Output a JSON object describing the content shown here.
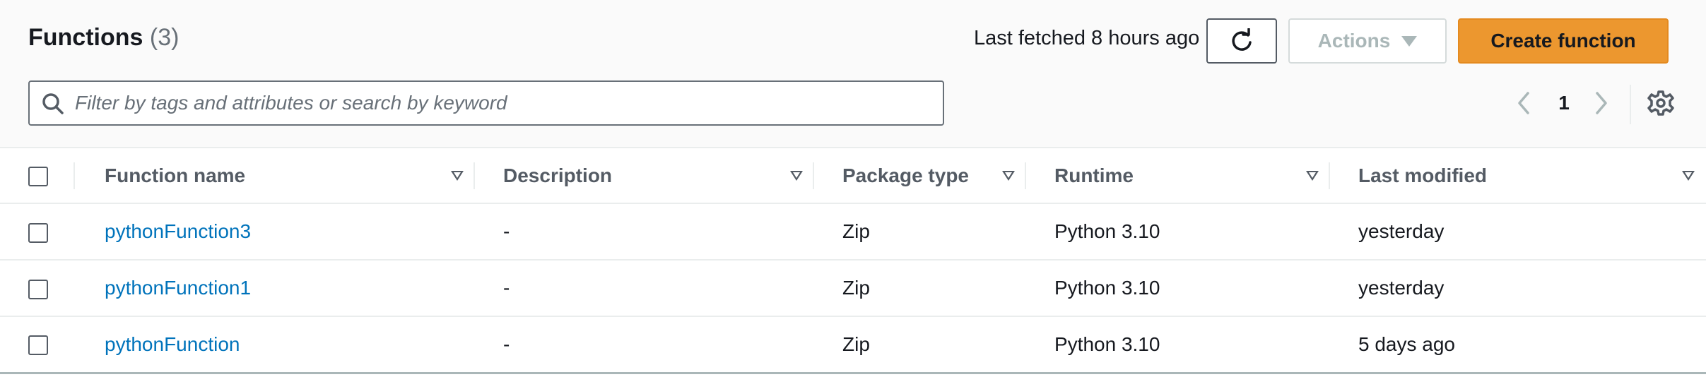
{
  "header": {
    "title": "Functions",
    "count": "(3)",
    "last_fetched": "Last fetched 8 hours ago",
    "refresh_icon": "refresh-icon",
    "actions_label": "Actions",
    "create_label": "Create function",
    "accent_color": "#ec972f"
  },
  "search": {
    "placeholder": "Filter by tags and attributes or search by keyword",
    "value": ""
  },
  "pagination": {
    "page": "1"
  },
  "table": {
    "columns": [
      "Function name",
      "Description",
      "Package type",
      "Runtime",
      "Last modified"
    ],
    "rows": [
      {
        "name": "pythonFunction3",
        "description": "-",
        "package_type": "Zip",
        "runtime": "Python 3.10",
        "last_modified": "yesterday"
      },
      {
        "name": "pythonFunction1",
        "description": "-",
        "package_type": "Zip",
        "runtime": "Python 3.10",
        "last_modified": "yesterday"
      },
      {
        "name": "pythonFunction",
        "description": "-",
        "package_type": "Zip",
        "runtime": "Python 3.10",
        "last_modified": "5 days ago"
      }
    ]
  }
}
